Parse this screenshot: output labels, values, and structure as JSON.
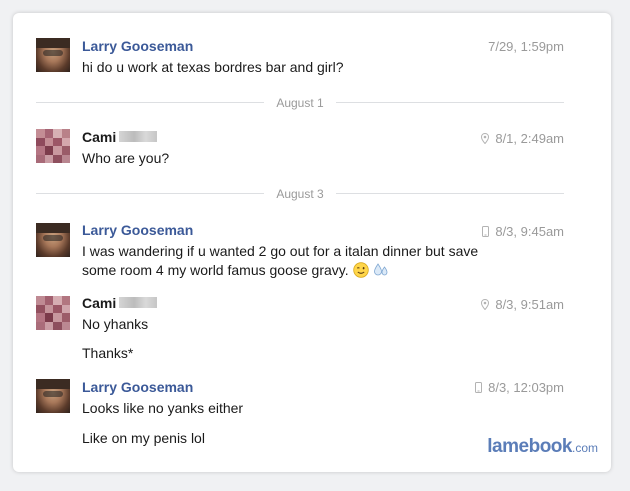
{
  "messages": [
    {
      "sender": "Larry Gooseman",
      "time": "7/29, 1:59pm",
      "lines": [
        "hi do u work at texas bordres bar and girl?"
      ]
    },
    {
      "sender": "Cami",
      "time": "8/1, 2:49am",
      "time_icon": "location-pin-icon",
      "lines": [
        "Who are you?"
      ]
    },
    {
      "sender": "Larry Gooseman",
      "time": "8/3, 9:45am",
      "time_icon": "mobile-phone-icon",
      "lines": [
        "I was wandering if u wanted 2 go out for a italan dinner but save",
        "some room 4 my world famus goose gravy."
      ]
    },
    {
      "sender": "Cami",
      "time": "8/3, 9:51am",
      "time_icon": "location-pin-icon",
      "lines": [
        "No yhanks",
        "Thanks*"
      ]
    },
    {
      "sender": "Larry Gooseman",
      "time": "8/3, 12:03pm",
      "time_icon": "mobile-phone-icon",
      "lines": [
        "Looks like no yanks either",
        "Like on my penis lol"
      ]
    }
  ],
  "dividers": [
    "August 1",
    "August 3"
  ],
  "emojis": [
    "winking-face-icon",
    "sweat-droplets-icon"
  ],
  "watermark": {
    "brand": "lamebook",
    "suffix": ".com"
  },
  "colors": {
    "name_blue": "#3b5998",
    "meta_gray": "#9a9a9a",
    "watermark_blue": "#5b7db8"
  }
}
